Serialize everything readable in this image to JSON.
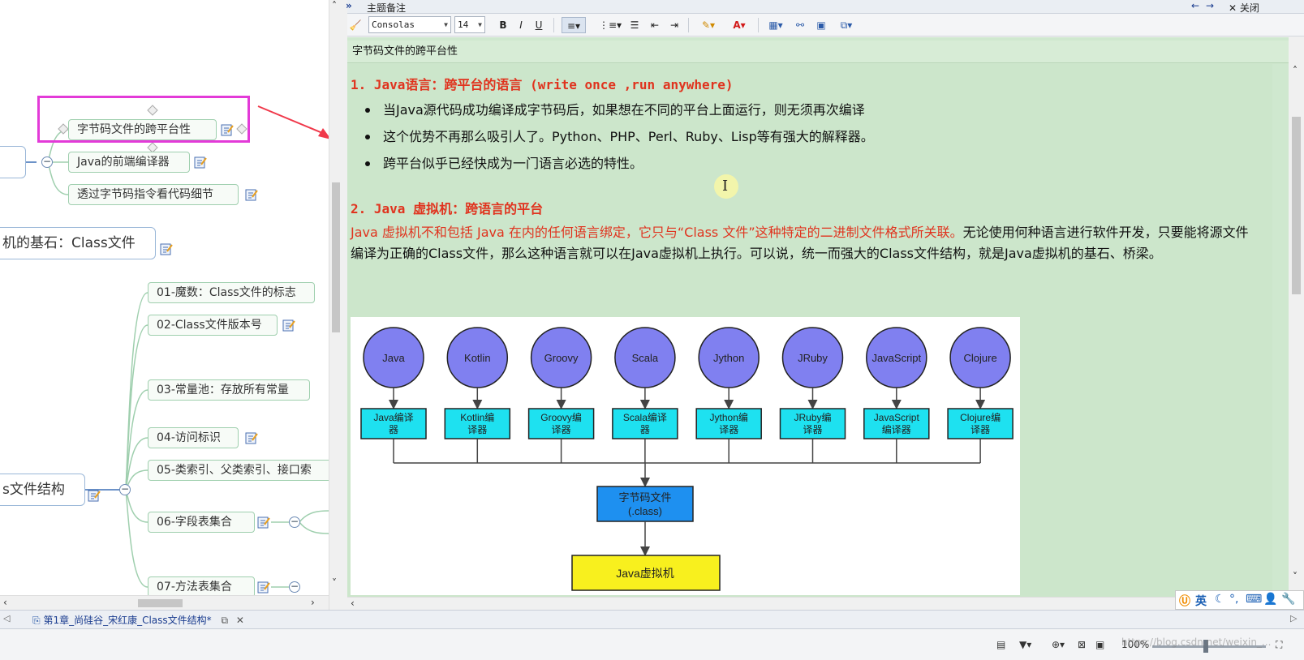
{
  "mindmap": {
    "topics": [
      {
        "id": "t1",
        "label": "字节码文件的跨平台性"
      },
      {
        "id": "t2",
        "label": "Java的前端编译器"
      },
      {
        "id": "t3",
        "label": "透过字节码指令看代码细节"
      },
      {
        "id": "t4",
        "label": "机的基石：Class文件"
      },
      {
        "id": "t5",
        "label": "01-魔数：Class文件的标志"
      },
      {
        "id": "t6",
        "label": "02-Class文件版本号"
      },
      {
        "id": "t7",
        "label": "03-常量池：存放所有常量"
      },
      {
        "id": "t8",
        "label": "04-访问标识"
      },
      {
        "id": "t9",
        "label": "05-类索引、父类索引、接口索"
      },
      {
        "id": "t10",
        "label": "s文件结构"
      },
      {
        "id": "t11",
        "label": "06-字段表集合"
      },
      {
        "id": "t12",
        "label": "07-方法表集合"
      }
    ],
    "collapse_symbol": "−",
    "highlight_color": "#e33ad8",
    "arrow_color": "#f0384a"
  },
  "notes_panel": {
    "collapse_symbol": "»",
    "title": "主题备注",
    "nav_back": "←",
    "nav_forward": "→",
    "close_label": "✕ 关闭",
    "toolbar": {
      "font_family": "Consolas",
      "font_size": "14",
      "bold": "B",
      "italic": "I",
      "underline": "U",
      "font_color_glyph": "A"
    },
    "note_title": "字节码文件的跨平台性",
    "heading1": "1. Java语言：跨平台的语言 (write once ,run anywhere)",
    "bullets": [
      "当Java源代码成功编译成字节码后，如果想在不同的平台上面运行，则无须再次编译",
      "这个优势不再那么吸引人了。Python、PHP、Perl、Ruby、Lisp等有强大的解释器。",
      "跨平台似乎已经快成为一门语言必选的特性。"
    ],
    "heading2": "2. Java 虚拟机：跨语言的平台",
    "paragraph_red": "Java 虚拟机不和包括 Java 在内的任何语言绑定，它只与“Class 文件”这种特定的二进制文件格式所关联。",
    "paragraph_black": "无论使用何种语言进行软件开发，只要能将源文件编译为正确的Class文件，那么这种语言就可以在Java虚拟机上执行。可以说，统一而强大的Class文件结构，就是Java虚拟机的基石、桥梁。",
    "cursor_glyph": "I"
  },
  "diagram": {
    "languages": [
      "Java",
      "Kotlin",
      "Groovy",
      "Scala",
      "Jython",
      "JRuby",
      "JavaScript",
      "Clojure"
    ],
    "compilers": [
      [
        "Java编译",
        "器"
      ],
      [
        "Kotlin编",
        "译器"
      ],
      [
        "Groovy编",
        "译器"
      ],
      [
        "Scala编译",
        "器"
      ],
      [
        "Jython编",
        "译器"
      ],
      [
        "JRuby编",
        "译器"
      ],
      [
        "JavaScript",
        "编译器"
      ],
      [
        "Clojure编",
        "译器"
      ]
    ],
    "bytecode": [
      "字节码文件",
      "(.class)"
    ],
    "jvm": "Java虚拟机",
    "colors": {
      "circle": "#8080f0",
      "compiler_box": "#1ee1f0",
      "bytecode_box": "#1e90f0",
      "jvm_box": "#f8f01e"
    }
  },
  "ime": {
    "lang": "英",
    "items": [
      "☾",
      "°,",
      "⌨",
      "👤",
      "🔧"
    ]
  },
  "tabs": {
    "active_doc": "第1章_尚硅谷_宋红康_Class文件结构*",
    "close_glyph": "✕"
  },
  "status": {
    "zoom": "100%",
    "watermark": "https://blog.csdn.net/weixin_..."
  }
}
